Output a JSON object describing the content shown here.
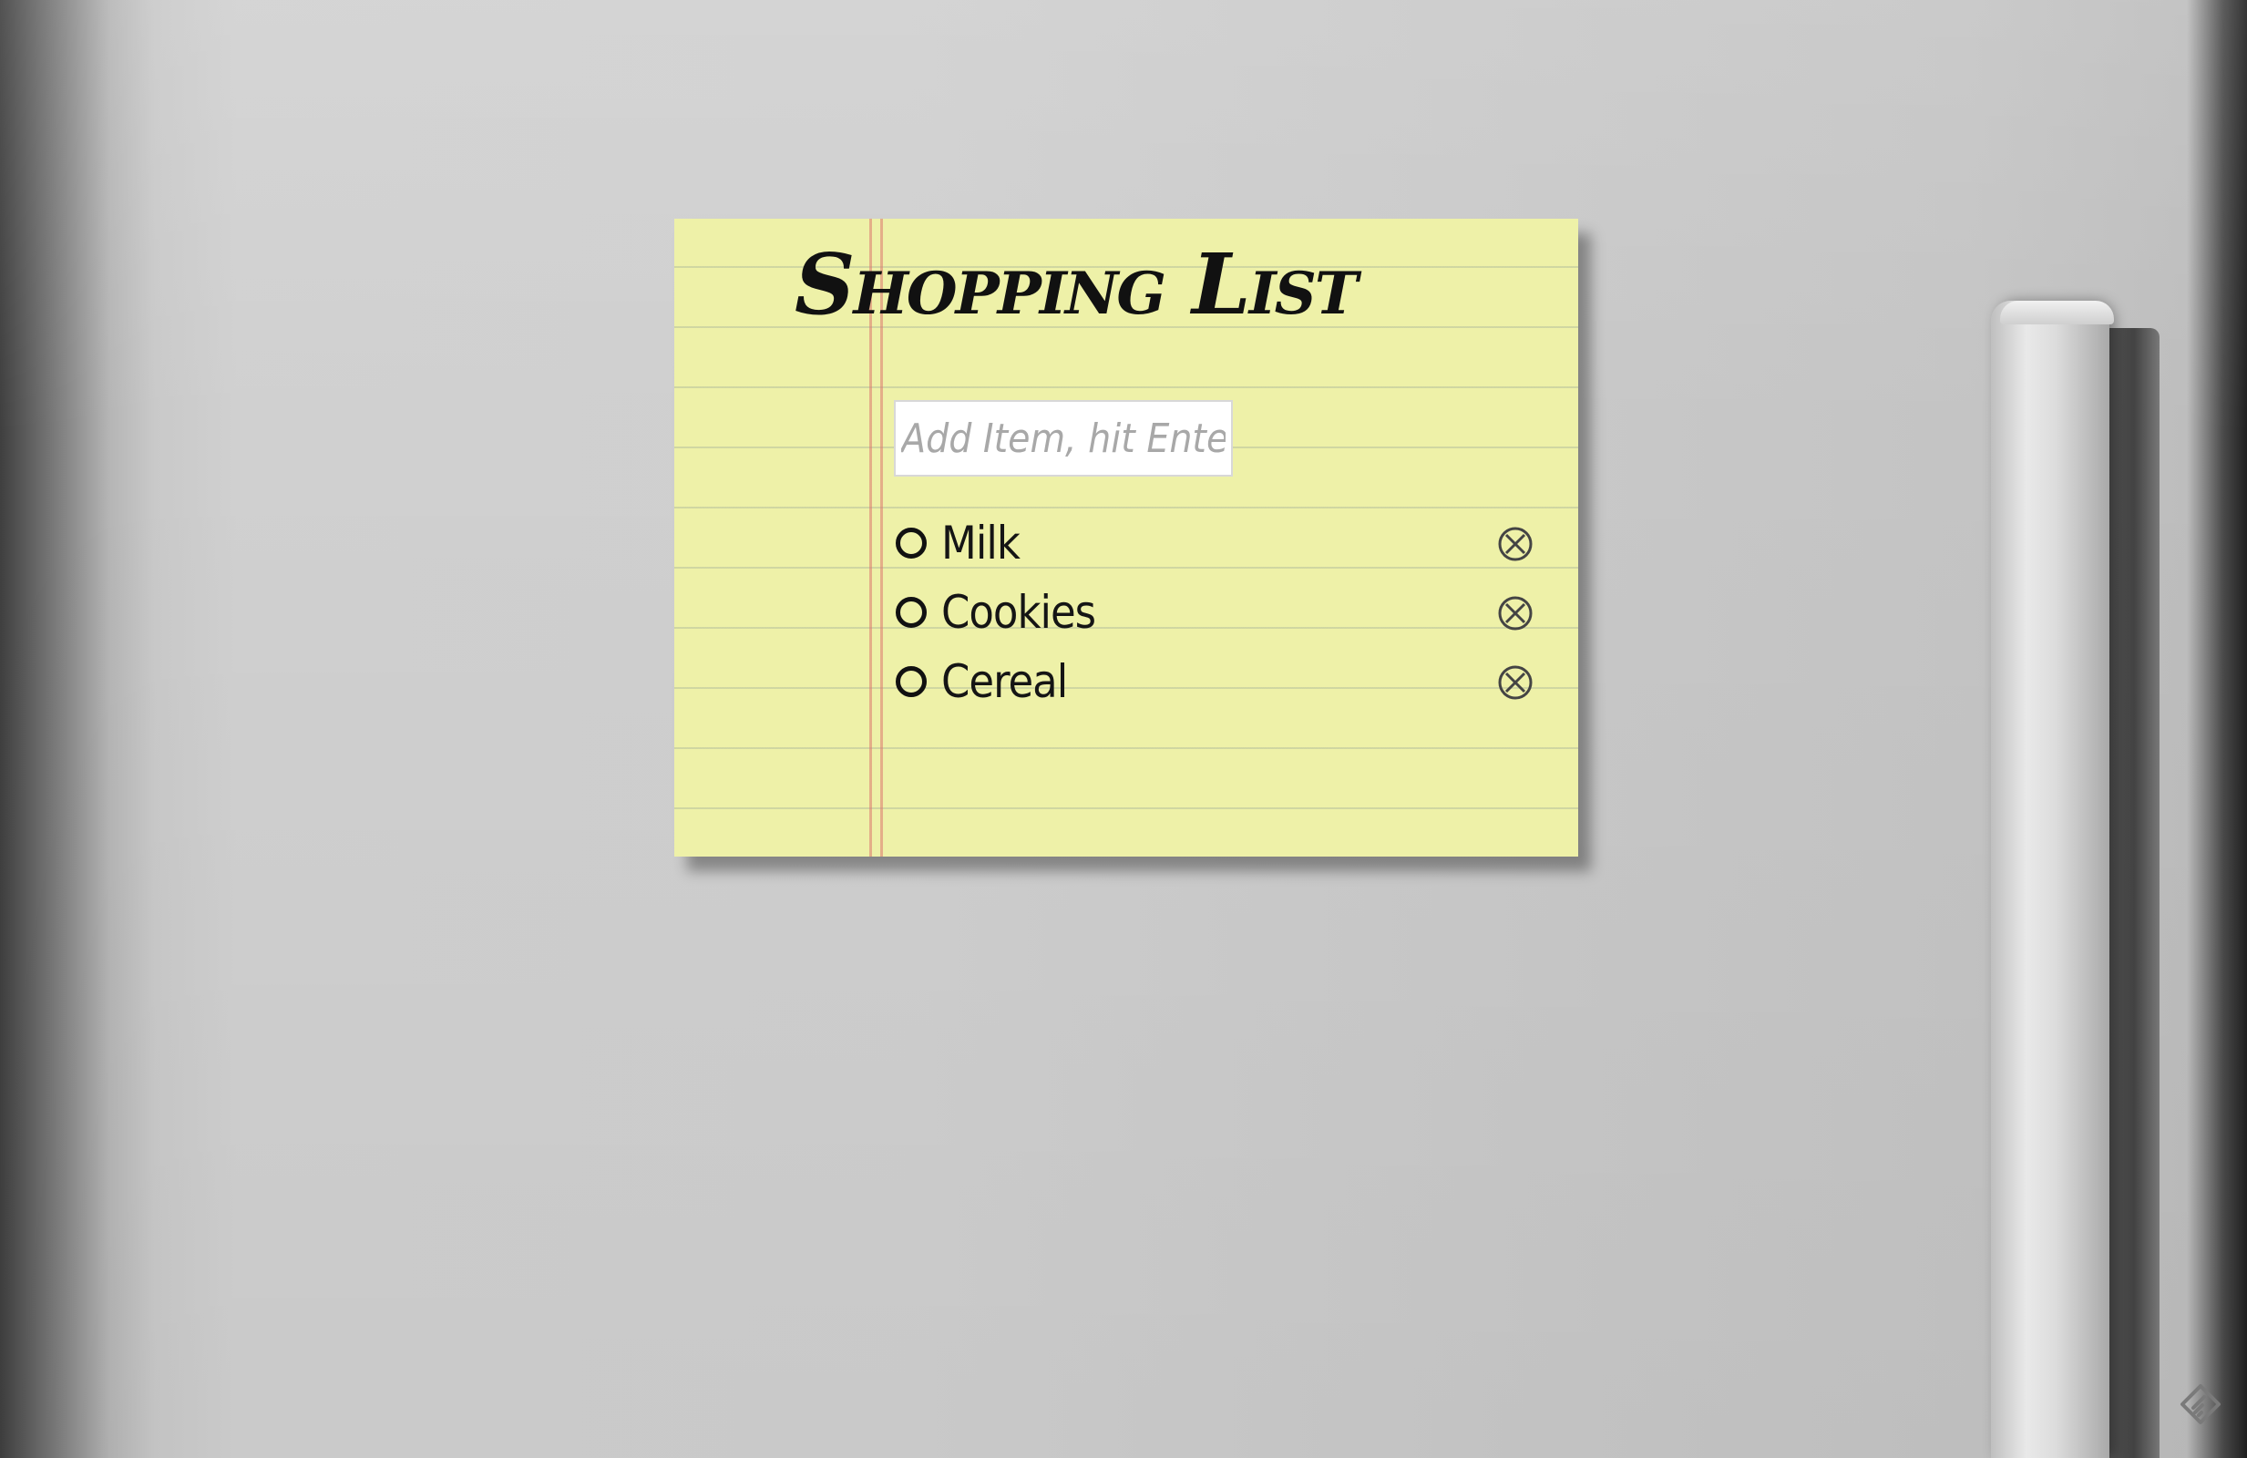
{
  "note": {
    "title": "Shopping List",
    "input_placeholder": "Add Item, hit Enter",
    "input_value": ""
  },
  "items": [
    {
      "label": "Milk",
      "checked": false,
      "check_icon": "circle-icon",
      "delete_icon": "circle-x-icon"
    },
    {
      "label": "Cookies",
      "checked": false,
      "check_icon": "circle-icon",
      "delete_icon": "circle-x-icon"
    },
    {
      "label": "Cereal",
      "checked": false,
      "check_icon": "circle-icon",
      "delete_icon": "circle-x-icon"
    }
  ],
  "colors": {
    "note_background": "#eef1a8",
    "ink": "#111111",
    "margin_line": "#dc786e",
    "fridge": "#cfcfcf"
  },
  "corner_icon": "feedly-icon"
}
